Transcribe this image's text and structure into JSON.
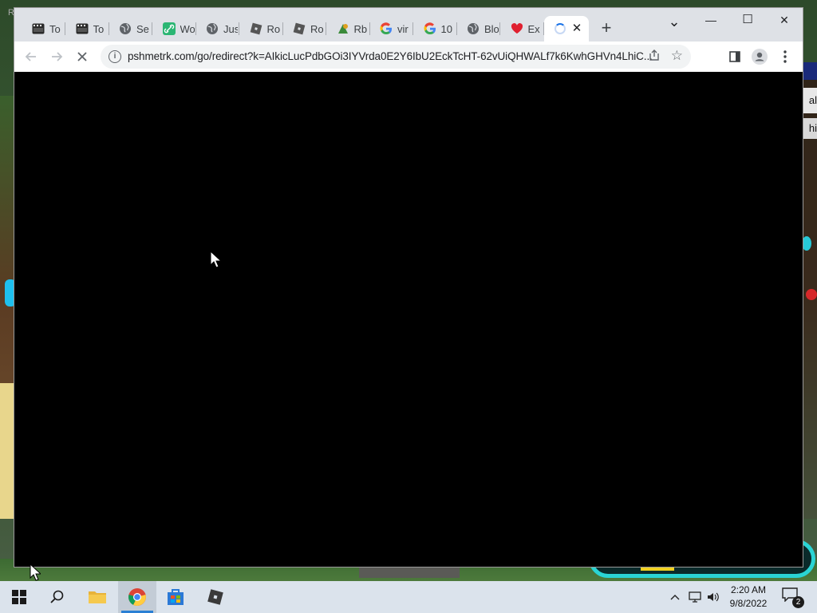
{
  "background": {
    "hud_right_1": "al",
    "hud_right_2": "hi",
    "corner_text": "R"
  },
  "browser": {
    "tabs": [
      {
        "icon": "film-icon",
        "title": "To"
      },
      {
        "icon": "film-icon",
        "title": "To"
      },
      {
        "icon": "globe-icon",
        "title": "Se"
      },
      {
        "icon": "link-icon",
        "title": "Wo"
      },
      {
        "icon": "globe-icon",
        "title": "Jus"
      },
      {
        "icon": "roblox-icon",
        "title": "Ro"
      },
      {
        "icon": "roblox-icon",
        "title": "Ro"
      },
      {
        "icon": "rbx-icon",
        "title": "Rb"
      },
      {
        "icon": "google-icon",
        "title": "vir"
      },
      {
        "icon": "google-icon",
        "title": "10"
      },
      {
        "icon": "globe-icon",
        "title": "Blo"
      },
      {
        "icon": "heart-icon",
        "title": "Ex"
      }
    ],
    "active_tab": {
      "state": "loading",
      "close_label": "✕"
    },
    "new_tab_label": "+",
    "url": "pshmetrk.com/go/redirect?k=AIkicLucPdbGOi3IYVrda0E2Y6IbU2EckTcHT-62vUiQHWALf7k6KwhGHVn4LhiC...",
    "window_controls": {
      "tab_search": "⌄",
      "minimize": "—",
      "maximize": "☐",
      "close": "✕"
    }
  },
  "taskbar": {
    "time": "2:20 AM",
    "date": "9/8/2022",
    "notification_count": "2",
    "colors": {
      "accent": "#2a7fd4",
      "taskbar_bg": "#dbe3ec"
    }
  }
}
